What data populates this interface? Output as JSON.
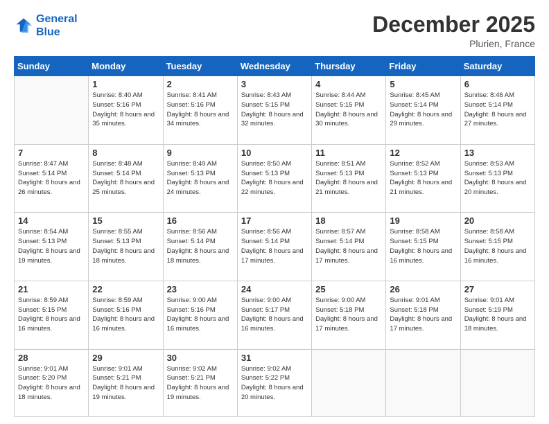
{
  "header": {
    "logo_line1": "General",
    "logo_line2": "Blue",
    "title": "December 2025",
    "location": "Plurien, France"
  },
  "weekdays": [
    "Sunday",
    "Monday",
    "Tuesday",
    "Wednesday",
    "Thursday",
    "Friday",
    "Saturday"
  ],
  "weeks": [
    [
      {
        "day": "",
        "sunrise": "",
        "sunset": "",
        "daylight": ""
      },
      {
        "day": "1",
        "sunrise": "Sunrise: 8:40 AM",
        "sunset": "Sunset: 5:16 PM",
        "daylight": "Daylight: 8 hours and 35 minutes."
      },
      {
        "day": "2",
        "sunrise": "Sunrise: 8:41 AM",
        "sunset": "Sunset: 5:16 PM",
        "daylight": "Daylight: 8 hours and 34 minutes."
      },
      {
        "day": "3",
        "sunrise": "Sunrise: 8:43 AM",
        "sunset": "Sunset: 5:15 PM",
        "daylight": "Daylight: 8 hours and 32 minutes."
      },
      {
        "day": "4",
        "sunrise": "Sunrise: 8:44 AM",
        "sunset": "Sunset: 5:15 PM",
        "daylight": "Daylight: 8 hours and 30 minutes."
      },
      {
        "day": "5",
        "sunrise": "Sunrise: 8:45 AM",
        "sunset": "Sunset: 5:14 PM",
        "daylight": "Daylight: 8 hours and 29 minutes."
      },
      {
        "day": "6",
        "sunrise": "Sunrise: 8:46 AM",
        "sunset": "Sunset: 5:14 PM",
        "daylight": "Daylight: 8 hours and 27 minutes."
      }
    ],
    [
      {
        "day": "7",
        "sunrise": "Sunrise: 8:47 AM",
        "sunset": "Sunset: 5:14 PM",
        "daylight": "Daylight: 8 hours and 26 minutes."
      },
      {
        "day": "8",
        "sunrise": "Sunrise: 8:48 AM",
        "sunset": "Sunset: 5:14 PM",
        "daylight": "Daylight: 8 hours and 25 minutes."
      },
      {
        "day": "9",
        "sunrise": "Sunrise: 8:49 AM",
        "sunset": "Sunset: 5:13 PM",
        "daylight": "Daylight: 8 hours and 24 minutes."
      },
      {
        "day": "10",
        "sunrise": "Sunrise: 8:50 AM",
        "sunset": "Sunset: 5:13 PM",
        "daylight": "Daylight: 8 hours and 22 minutes."
      },
      {
        "day": "11",
        "sunrise": "Sunrise: 8:51 AM",
        "sunset": "Sunset: 5:13 PM",
        "daylight": "Daylight: 8 hours and 21 minutes."
      },
      {
        "day": "12",
        "sunrise": "Sunrise: 8:52 AM",
        "sunset": "Sunset: 5:13 PM",
        "daylight": "Daylight: 8 hours and 21 minutes."
      },
      {
        "day": "13",
        "sunrise": "Sunrise: 8:53 AM",
        "sunset": "Sunset: 5:13 PM",
        "daylight": "Daylight: 8 hours and 20 minutes."
      }
    ],
    [
      {
        "day": "14",
        "sunrise": "Sunrise: 8:54 AM",
        "sunset": "Sunset: 5:13 PM",
        "daylight": "Daylight: 8 hours and 19 minutes."
      },
      {
        "day": "15",
        "sunrise": "Sunrise: 8:55 AM",
        "sunset": "Sunset: 5:13 PM",
        "daylight": "Daylight: 8 hours and 18 minutes."
      },
      {
        "day": "16",
        "sunrise": "Sunrise: 8:56 AM",
        "sunset": "Sunset: 5:14 PM",
        "daylight": "Daylight: 8 hours and 18 minutes."
      },
      {
        "day": "17",
        "sunrise": "Sunrise: 8:56 AM",
        "sunset": "Sunset: 5:14 PM",
        "daylight": "Daylight: 8 hours and 17 minutes."
      },
      {
        "day": "18",
        "sunrise": "Sunrise: 8:57 AM",
        "sunset": "Sunset: 5:14 PM",
        "daylight": "Daylight: 8 hours and 17 minutes."
      },
      {
        "day": "19",
        "sunrise": "Sunrise: 8:58 AM",
        "sunset": "Sunset: 5:15 PM",
        "daylight": "Daylight: 8 hours and 16 minutes."
      },
      {
        "day": "20",
        "sunrise": "Sunrise: 8:58 AM",
        "sunset": "Sunset: 5:15 PM",
        "daylight": "Daylight: 8 hours and 16 minutes."
      }
    ],
    [
      {
        "day": "21",
        "sunrise": "Sunrise: 8:59 AM",
        "sunset": "Sunset: 5:15 PM",
        "daylight": "Daylight: 8 hours and 16 minutes."
      },
      {
        "day": "22",
        "sunrise": "Sunrise: 8:59 AM",
        "sunset": "Sunset: 5:16 PM",
        "daylight": "Daylight: 8 hours and 16 minutes."
      },
      {
        "day": "23",
        "sunrise": "Sunrise: 9:00 AM",
        "sunset": "Sunset: 5:16 PM",
        "daylight": "Daylight: 8 hours and 16 minutes."
      },
      {
        "day": "24",
        "sunrise": "Sunrise: 9:00 AM",
        "sunset": "Sunset: 5:17 PM",
        "daylight": "Daylight: 8 hours and 16 minutes."
      },
      {
        "day": "25",
        "sunrise": "Sunrise: 9:00 AM",
        "sunset": "Sunset: 5:18 PM",
        "daylight": "Daylight: 8 hours and 17 minutes."
      },
      {
        "day": "26",
        "sunrise": "Sunrise: 9:01 AM",
        "sunset": "Sunset: 5:18 PM",
        "daylight": "Daylight: 8 hours and 17 minutes."
      },
      {
        "day": "27",
        "sunrise": "Sunrise: 9:01 AM",
        "sunset": "Sunset: 5:19 PM",
        "daylight": "Daylight: 8 hours and 18 minutes."
      }
    ],
    [
      {
        "day": "28",
        "sunrise": "Sunrise: 9:01 AM",
        "sunset": "Sunset: 5:20 PM",
        "daylight": "Daylight: 8 hours and 18 minutes."
      },
      {
        "day": "29",
        "sunrise": "Sunrise: 9:01 AM",
        "sunset": "Sunset: 5:21 PM",
        "daylight": "Daylight: 8 hours and 19 minutes."
      },
      {
        "day": "30",
        "sunrise": "Sunrise: 9:02 AM",
        "sunset": "Sunset: 5:21 PM",
        "daylight": "Daylight: 8 hours and 19 minutes."
      },
      {
        "day": "31",
        "sunrise": "Sunrise: 9:02 AM",
        "sunset": "Sunset: 5:22 PM",
        "daylight": "Daylight: 8 hours and 20 minutes."
      },
      {
        "day": "",
        "sunrise": "",
        "sunset": "",
        "daylight": ""
      },
      {
        "day": "",
        "sunrise": "",
        "sunset": "",
        "daylight": ""
      },
      {
        "day": "",
        "sunrise": "",
        "sunset": "",
        "daylight": ""
      }
    ]
  ]
}
